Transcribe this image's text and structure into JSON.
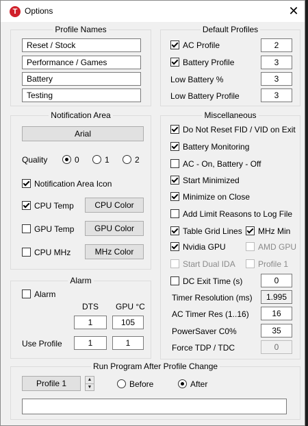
{
  "window": {
    "title": "Options",
    "app_icon_letter": "T",
    "close_glyph": "✕"
  },
  "profile_names": {
    "title": "Profile Names",
    "names": [
      "Reset / Stock",
      "Performance / Games",
      "Battery",
      "Testing"
    ]
  },
  "default_profiles": {
    "title": "Default Profiles",
    "ac_profile": {
      "label": "AC Profile",
      "checked": true,
      "value": "2"
    },
    "battery_profile": {
      "label": "Battery Profile",
      "checked": true,
      "value": "3"
    },
    "low_battery_pct": {
      "label": "Low Battery %",
      "value": "3"
    },
    "low_battery_profile": {
      "label": "Low Battery Profile",
      "value": "3"
    }
  },
  "notification": {
    "title": "Notification Area",
    "font_button": "Arial",
    "quality_label": "Quality",
    "quality_options": [
      "0",
      "1",
      "2"
    ],
    "quality_selected": "0",
    "icon_label": "Notification Area Icon",
    "cpu_temp_label": "CPU Temp",
    "cpu_color_button": "CPU Color",
    "gpu_temp_label": "GPU Temp",
    "gpu_color_button": "GPU Color",
    "cpu_mhz_label": "CPU MHz",
    "mhz_color_button": "MHz Color"
  },
  "misc": {
    "title": "Miscellaneous",
    "do_not_reset": "Do Not Reset FID / VID on Exit",
    "battery_monitoring": "Battery Monitoring",
    "ac_on_battery_off": "AC - On, Battery - Off",
    "start_minimized": "Start Minimized",
    "minimize_on_close": "Minimize on Close",
    "add_limit_reasons": "Add Limit Reasons to Log File",
    "table_grid_lines": "Table Grid Lines",
    "mhz_min": "MHz Min",
    "nvidia_gpu": "Nvidia GPU",
    "amd_gpu": "AMD GPU",
    "start_dual_ida": "Start Dual IDA",
    "profile_1": "Profile 1",
    "dc_exit_time": {
      "label": "DC Exit Time (s)",
      "value": "0"
    },
    "timer_resolution": {
      "label": "Timer Resolution (ms)",
      "value": "1.995"
    },
    "ac_timer_res": {
      "label": "AC Timer Res (1..16)",
      "value": "16"
    },
    "powersaver": {
      "label": "PowerSaver C0%",
      "value": "35"
    },
    "force_tdp": {
      "label": "Force TDP / TDC",
      "value": "0"
    }
  },
  "alarm": {
    "title": "Alarm",
    "alarm_label": "Alarm",
    "dts_header": "DTS",
    "gpu_header": "GPU °C",
    "dts_value": "1",
    "gpu_value": "105",
    "use_profile_label": "Use Profile",
    "use_profile_dts": "1",
    "use_profile_gpu": "1"
  },
  "run_program": {
    "title": "Run Program After Profile Change",
    "profile_button": "Profile 1",
    "before_label": "Before",
    "after_label": "After",
    "selected": "After",
    "path_value": ""
  },
  "colors": {
    "window_bg": "#f0f0f0",
    "app_icon": "#d0202a",
    "desktop": "#1e1e1e"
  }
}
